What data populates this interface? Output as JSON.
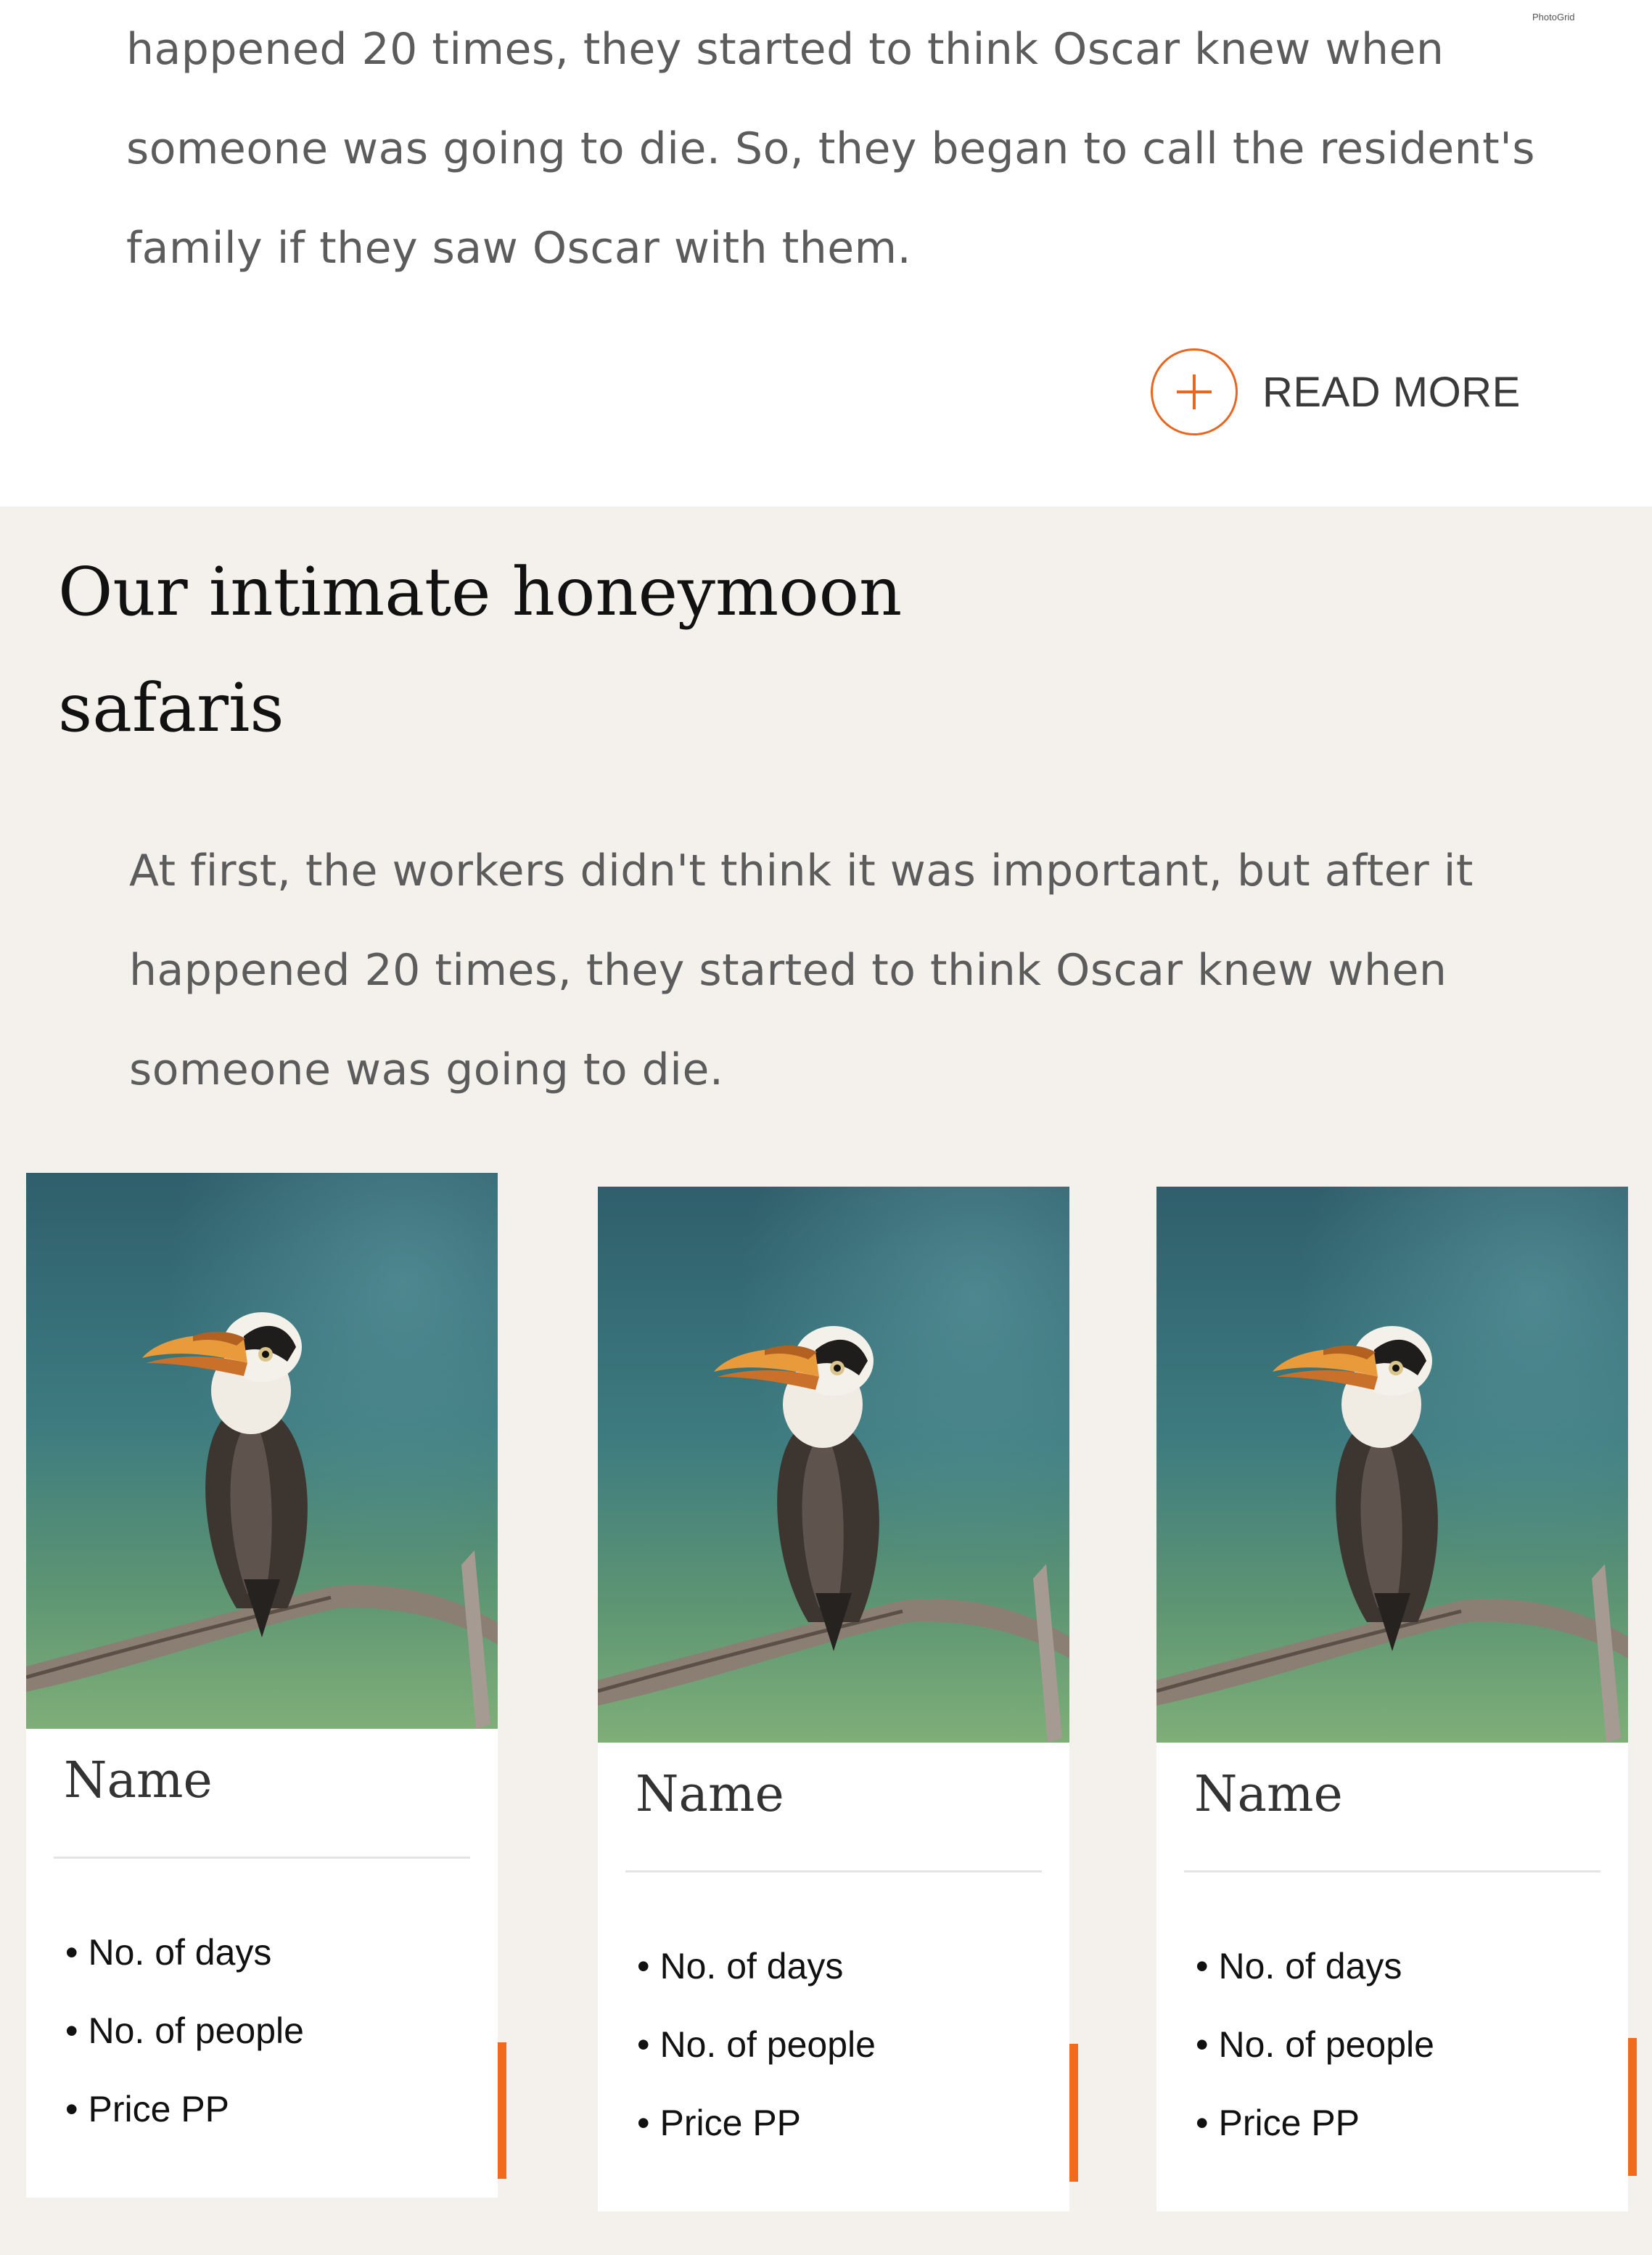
{
  "watermark": "PhotoGrid",
  "intro": {
    "lines": [
      "happened 20 times, they started to think Oscar knew when",
      "someone was going to die. So, they began to call the resident's",
      "family if they saw Oscar with them."
    ],
    "read_more_label": "READ MORE"
  },
  "section": {
    "title_lines": [
      "Our intimate honeymoon",
      "safaris"
    ],
    "body_lines": [
      "At first, the workers didn't think it was important, but after it",
      "happened 20 times, they started to think Oscar knew when",
      "someone was going to die."
    ]
  },
  "cards": [
    {
      "name": "Name",
      "items": [
        "No. of days",
        "No. of people",
        "Price PP"
      ]
    },
    {
      "name": "Name",
      "items": [
        "No. of days",
        "No. of people",
        "Price PP"
      ]
    },
    {
      "name": "Name",
      "items": [
        "No. of days",
        "No. of people",
        "Price PP"
      ]
    }
  ],
  "colors": {
    "accent": "#e8661f",
    "section_bg": "#f4f1ec",
    "card_accent_bar": "#f26b1d"
  }
}
